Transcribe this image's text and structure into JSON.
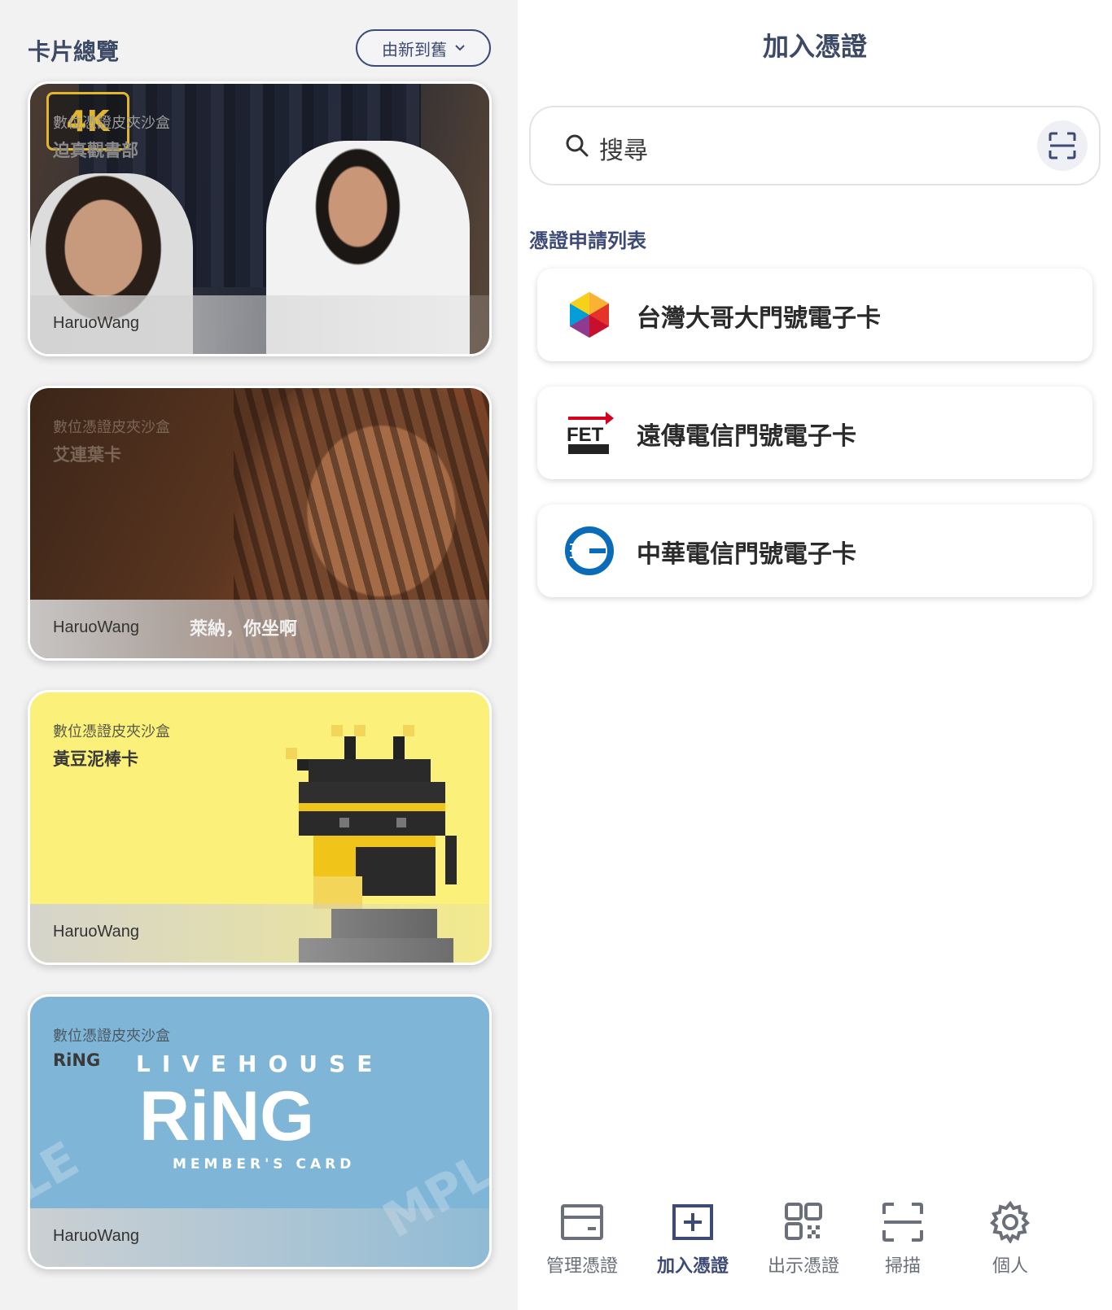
{
  "left": {
    "title": "卡片總覽",
    "sort_label": "由新到舊",
    "cards": [
      {
        "issuer": "數位憑證皮夾沙盒",
        "name": "迫真觀書部",
        "owner": "HaruoWang",
        "badge": "4K"
      },
      {
        "issuer": "數位憑證皮夾沙盒",
        "name": "艾連葉卡",
        "owner": "HaruoWang",
        "subtitle": "萊納，你坐啊"
      },
      {
        "issuer": "數位憑證皮夾沙盒",
        "name": "黃豆泥棒卡",
        "owner": "HaruoWang"
      },
      {
        "issuer": "數位憑證皮夾沙盒",
        "name": "RiNG",
        "owner": "HaruoWang",
        "art_text": {
          "livehouse": "LIVEHOUSE",
          "ring": "RiNG",
          "member": "MEMBER'S CARD"
        }
      }
    ]
  },
  "right": {
    "title": "加入憑證",
    "search_placeholder": "搜尋",
    "section_label": "憑證申請列表",
    "apply_items": [
      {
        "label": "台灣大哥大門號電子卡",
        "icon": "taiwan-mobile-logo"
      },
      {
        "label": "遠傳電信門號電子卡",
        "icon": "fet-logo",
        "logo_text": "FET"
      },
      {
        "label": "中華電信門號電子卡",
        "icon": "chunghwa-telecom-logo"
      }
    ],
    "nav": [
      {
        "label": "管理憑證",
        "icon": "wallet-icon",
        "active": false
      },
      {
        "label": "加入憑證",
        "icon": "add-square-icon",
        "active": true
      },
      {
        "label": "出示憑證",
        "icon": "qr-code-icon",
        "active": false
      },
      {
        "label": "掃描",
        "icon": "scan-icon",
        "active": false
      },
      {
        "label": "個人",
        "icon": "gear-icon",
        "active": false
      }
    ]
  },
  "colors": {
    "accent": "#3d4a76",
    "nav_inactive": "#6a6f7a"
  }
}
